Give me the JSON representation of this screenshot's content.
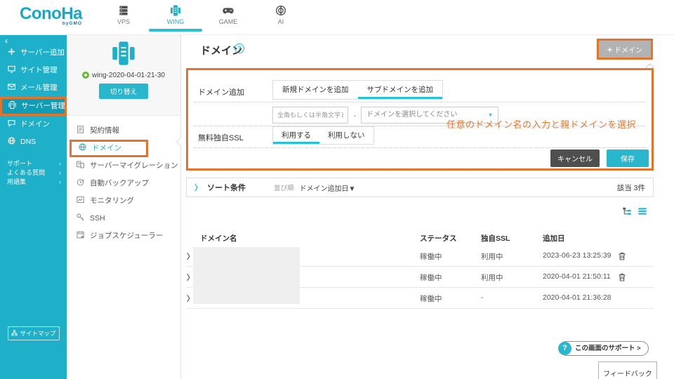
{
  "colors": {
    "brand_teal": "#1db0c8",
    "accent_teal": "#29c0d6",
    "highlight_orange": "#e4732c",
    "annotation_orange": "#e8752c",
    "disabled_button_gray": "#b3b3b3",
    "cancel_button_dark": "#4f4f4f",
    "status_green": "#67b92e"
  },
  "icons": {
    "plus": "+",
    "collapse_chevron": "‹",
    "link_chevron": "›",
    "row_chevron": "〉",
    "caret_down": "▼",
    "question_mark": "?",
    "dot_separator": "."
  },
  "topnav": {
    "logo_text": "ConoHa",
    "logo_sub": "byGMO",
    "items": [
      {
        "label": "VPS"
      },
      {
        "label": "WING"
      },
      {
        "label": "GAME"
      },
      {
        "label": "AI"
      }
    ]
  },
  "sidebar": {
    "items": [
      {
        "label": "サーバー追加"
      },
      {
        "label": "サイト管理"
      },
      {
        "label": "メール管理"
      },
      {
        "label": "サーバー管理"
      },
      {
        "label": "ドメイン"
      },
      {
        "label": "DNS"
      }
    ],
    "links": [
      {
        "label": "サポート"
      },
      {
        "label": "よくある質問"
      },
      {
        "label": "用語集"
      }
    ],
    "sitemap_label": "サイトマップ"
  },
  "server_panel": {
    "server_name": "wing-2020-04-01-21-30",
    "switch_button": "切り替え",
    "menu": [
      {
        "label": "契約情報"
      },
      {
        "label": "ドメイン"
      },
      {
        "label": "サーバーマイグレーション"
      },
      {
        "label": "自動バックアップ"
      },
      {
        "label": "モニタリング"
      },
      {
        "label": "SSH"
      },
      {
        "label": "ジョブスケジューラー"
      }
    ]
  },
  "main": {
    "title": "ドメイン",
    "add_button_label": "ドメイン",
    "form": {
      "add_label": "ドメイン追加",
      "tabs": [
        {
          "label": "新規ドメインを追加"
        },
        {
          "label": "サブドメインを追加"
        }
      ],
      "active_tab": "サブドメインを追加",
      "input_placeholder": "全角もしくは半角文字と-.",
      "select_placeholder": "ドメインを選択してください",
      "annotation": "任意のドメイン名の入力と親ドメインを選択",
      "ssl_label": "無料独自SSL",
      "ssl_options": [
        {
          "label": "利用する"
        },
        {
          "label": "利用しない"
        }
      ],
      "active_ssl_option": "利用する",
      "cancel_label": "キャンセル",
      "save_label": "保存"
    },
    "sort": {
      "label": "ソート条件",
      "order_label": "並び順",
      "order_value": "ドメイン追加日▼",
      "match_count": "該当 3件"
    },
    "table": {
      "headers": [
        "ドメイン名",
        "ステータス",
        "独自SSL",
        "追加日"
      ],
      "rows": [
        {
          "domain": "",
          "status": "稼働中",
          "ssl": "利用中",
          "added": "2023-06-23 13:25:39"
        },
        {
          "domain": "",
          "status": "稼働中",
          "ssl": "利用中",
          "added": "2020-04-01 21:50:11"
        },
        {
          "domain": "",
          "status": "稼働中",
          "ssl": "-",
          "added": "2020-04-01 21:36:28"
        }
      ]
    },
    "support_button": "この画面のサポート >",
    "feedback_button": "フィードバック"
  }
}
